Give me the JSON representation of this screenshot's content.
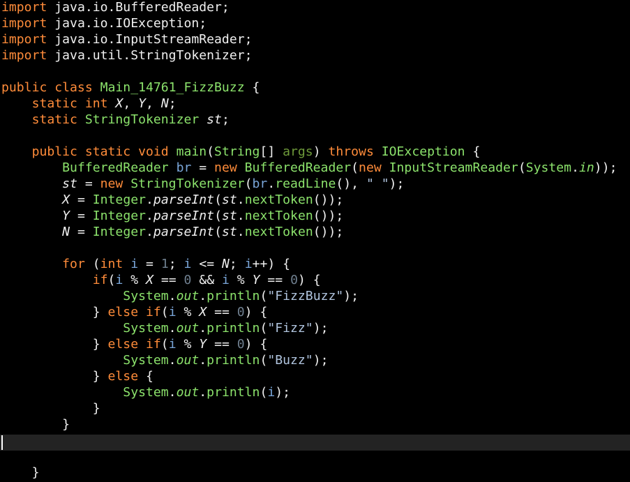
{
  "editor": {
    "language": "java",
    "theme_colors": {
      "background": "#000000",
      "keyword": "#ff8c3a",
      "default_text": "#f0f0f0",
      "type_and_method": "#8ce36c",
      "local_variable": "#7aa6d9",
      "parameter": "#6e9a3a",
      "number": "#6f7f8f",
      "string": "#b0c4de",
      "current_line": "#232323"
    },
    "current_line_index": 27,
    "lines": [
      [
        {
          "t": "import",
          "c": "keyword"
        },
        {
          "t": " java.io.BufferedReader;",
          "c": "plain"
        }
      ],
      [
        {
          "t": "import",
          "c": "keyword"
        },
        {
          "t": " java.io.IOException;",
          "c": "plain"
        }
      ],
      [
        {
          "t": "import",
          "c": "keyword"
        },
        {
          "t": " java.io.InputStreamReader;",
          "c": "plain"
        }
      ],
      [
        {
          "t": "import",
          "c": "keyword"
        },
        {
          "t": " java.util.StringTokenizer;",
          "c": "plain"
        }
      ],
      [],
      [
        {
          "t": "public class ",
          "c": "keyword"
        },
        {
          "t": "Main_14761_FizzBuzz",
          "c": "declaration"
        },
        {
          "t": " {",
          "c": "plain"
        }
      ],
      [
        {
          "t": "    ",
          "c": "plain"
        },
        {
          "t": "static int ",
          "c": "keyword"
        },
        {
          "t": "X",
          "c": "field"
        },
        {
          "t": ", ",
          "c": "plain"
        },
        {
          "t": "Y",
          "c": "field"
        },
        {
          "t": ", ",
          "c": "plain"
        },
        {
          "t": "N",
          "c": "field"
        },
        {
          "t": ";",
          "c": "plain"
        }
      ],
      [
        {
          "t": "    ",
          "c": "plain"
        },
        {
          "t": "static ",
          "c": "keyword"
        },
        {
          "t": "StringTokenizer ",
          "c": "type"
        },
        {
          "t": "st",
          "c": "field"
        },
        {
          "t": ";",
          "c": "plain"
        }
      ],
      [],
      [
        {
          "t": "    ",
          "c": "plain"
        },
        {
          "t": "public static void ",
          "c": "keyword"
        },
        {
          "t": "main",
          "c": "declaration"
        },
        {
          "t": "(",
          "c": "plain"
        },
        {
          "t": "String",
          "c": "type"
        },
        {
          "t": "[] ",
          "c": "plain"
        },
        {
          "t": "args",
          "c": "param"
        },
        {
          "t": ") ",
          "c": "plain"
        },
        {
          "t": "throws ",
          "c": "keyword"
        },
        {
          "t": "IOException",
          "c": "type"
        },
        {
          "t": " {",
          "c": "plain"
        }
      ],
      [
        {
          "t": "        ",
          "c": "plain"
        },
        {
          "t": "BufferedReader ",
          "c": "type"
        },
        {
          "t": "br",
          "c": "local"
        },
        {
          "t": " = ",
          "c": "plain"
        },
        {
          "t": "new ",
          "c": "keyword"
        },
        {
          "t": "BufferedReader",
          "c": "type"
        },
        {
          "t": "(",
          "c": "plain"
        },
        {
          "t": "new ",
          "c": "keyword"
        },
        {
          "t": "InputStreamReader",
          "c": "type"
        },
        {
          "t": "(",
          "c": "plain"
        },
        {
          "t": "System",
          "c": "type"
        },
        {
          "t": ".",
          "c": "plain"
        },
        {
          "t": "in",
          "c": "static-field"
        },
        {
          "t": "));",
          "c": "plain"
        }
      ],
      [
        {
          "t": "        ",
          "c": "plain"
        },
        {
          "t": "st",
          "c": "field"
        },
        {
          "t": " = ",
          "c": "plain"
        },
        {
          "t": "new ",
          "c": "keyword"
        },
        {
          "t": "StringTokenizer",
          "c": "type"
        },
        {
          "t": "(",
          "c": "plain"
        },
        {
          "t": "br",
          "c": "local"
        },
        {
          "t": ".",
          "c": "plain"
        },
        {
          "t": "readLine",
          "c": "method"
        },
        {
          "t": "(), ",
          "c": "plain"
        },
        {
          "t": "\" \"",
          "c": "string"
        },
        {
          "t": ");",
          "c": "plain"
        }
      ],
      [
        {
          "t": "        ",
          "c": "plain"
        },
        {
          "t": "X",
          "c": "field"
        },
        {
          "t": " = ",
          "c": "plain"
        },
        {
          "t": "Integer",
          "c": "type"
        },
        {
          "t": ".",
          "c": "plain"
        },
        {
          "t": "parseInt",
          "c": "static-method"
        },
        {
          "t": "(",
          "c": "plain"
        },
        {
          "t": "st",
          "c": "field"
        },
        {
          "t": ".",
          "c": "plain"
        },
        {
          "t": "nextToken",
          "c": "method"
        },
        {
          "t": "());",
          "c": "plain"
        }
      ],
      [
        {
          "t": "        ",
          "c": "plain"
        },
        {
          "t": "Y",
          "c": "field"
        },
        {
          "t": " = ",
          "c": "plain"
        },
        {
          "t": "Integer",
          "c": "type"
        },
        {
          "t": ".",
          "c": "plain"
        },
        {
          "t": "parseInt",
          "c": "static-method"
        },
        {
          "t": "(",
          "c": "plain"
        },
        {
          "t": "st",
          "c": "field"
        },
        {
          "t": ".",
          "c": "plain"
        },
        {
          "t": "nextToken",
          "c": "method"
        },
        {
          "t": "());",
          "c": "plain"
        }
      ],
      [
        {
          "t": "        ",
          "c": "plain"
        },
        {
          "t": "N",
          "c": "field"
        },
        {
          "t": " = ",
          "c": "plain"
        },
        {
          "t": "Integer",
          "c": "type"
        },
        {
          "t": ".",
          "c": "plain"
        },
        {
          "t": "parseInt",
          "c": "static-method"
        },
        {
          "t": "(",
          "c": "plain"
        },
        {
          "t": "st",
          "c": "field"
        },
        {
          "t": ".",
          "c": "plain"
        },
        {
          "t": "nextToken",
          "c": "method"
        },
        {
          "t": "());",
          "c": "plain"
        }
      ],
      [],
      [
        {
          "t": "        ",
          "c": "plain"
        },
        {
          "t": "for ",
          "c": "keyword"
        },
        {
          "t": "(",
          "c": "plain"
        },
        {
          "t": "int ",
          "c": "keyword"
        },
        {
          "t": "i",
          "c": "local"
        },
        {
          "t": " = ",
          "c": "plain"
        },
        {
          "t": "1",
          "c": "number"
        },
        {
          "t": "; ",
          "c": "plain"
        },
        {
          "t": "i",
          "c": "local"
        },
        {
          "t": " <= ",
          "c": "plain"
        },
        {
          "t": "N",
          "c": "field"
        },
        {
          "t": "; ",
          "c": "plain"
        },
        {
          "t": "i",
          "c": "local"
        },
        {
          "t": "++) {",
          "c": "plain"
        }
      ],
      [
        {
          "t": "            ",
          "c": "plain"
        },
        {
          "t": "if",
          "c": "keyword"
        },
        {
          "t": "(",
          "c": "plain"
        },
        {
          "t": "i",
          "c": "local"
        },
        {
          "t": " % ",
          "c": "plain"
        },
        {
          "t": "X",
          "c": "field"
        },
        {
          "t": " == ",
          "c": "plain"
        },
        {
          "t": "0",
          "c": "number"
        },
        {
          "t": " && ",
          "c": "plain"
        },
        {
          "t": "i",
          "c": "local"
        },
        {
          "t": " % ",
          "c": "plain"
        },
        {
          "t": "Y",
          "c": "field"
        },
        {
          "t": " == ",
          "c": "plain"
        },
        {
          "t": "0",
          "c": "number"
        },
        {
          "t": ") {",
          "c": "plain"
        }
      ],
      [
        {
          "t": "                ",
          "c": "plain"
        },
        {
          "t": "System",
          "c": "type"
        },
        {
          "t": ".",
          "c": "plain"
        },
        {
          "t": "out",
          "c": "static-field"
        },
        {
          "t": ".",
          "c": "plain"
        },
        {
          "t": "println",
          "c": "method"
        },
        {
          "t": "(",
          "c": "plain"
        },
        {
          "t": "\"FizzBuzz\"",
          "c": "string"
        },
        {
          "t": ");",
          "c": "plain"
        }
      ],
      [
        {
          "t": "            } ",
          "c": "plain"
        },
        {
          "t": "else if",
          "c": "keyword"
        },
        {
          "t": "(",
          "c": "plain"
        },
        {
          "t": "i",
          "c": "local"
        },
        {
          "t": " % ",
          "c": "plain"
        },
        {
          "t": "X",
          "c": "field"
        },
        {
          "t": " == ",
          "c": "plain"
        },
        {
          "t": "0",
          "c": "number"
        },
        {
          "t": ") {",
          "c": "plain"
        }
      ],
      [
        {
          "t": "                ",
          "c": "plain"
        },
        {
          "t": "System",
          "c": "type"
        },
        {
          "t": ".",
          "c": "plain"
        },
        {
          "t": "out",
          "c": "static-field"
        },
        {
          "t": ".",
          "c": "plain"
        },
        {
          "t": "println",
          "c": "method"
        },
        {
          "t": "(",
          "c": "plain"
        },
        {
          "t": "\"Fizz\"",
          "c": "string"
        },
        {
          "t": ");",
          "c": "plain"
        }
      ],
      [
        {
          "t": "            } ",
          "c": "plain"
        },
        {
          "t": "else if",
          "c": "keyword"
        },
        {
          "t": "(",
          "c": "plain"
        },
        {
          "t": "i",
          "c": "local"
        },
        {
          "t": " % ",
          "c": "plain"
        },
        {
          "t": "Y",
          "c": "field"
        },
        {
          "t": " == ",
          "c": "plain"
        },
        {
          "t": "0",
          "c": "number"
        },
        {
          "t": ") {",
          "c": "plain"
        }
      ],
      [
        {
          "t": "                ",
          "c": "plain"
        },
        {
          "t": "System",
          "c": "type"
        },
        {
          "t": ".",
          "c": "plain"
        },
        {
          "t": "out",
          "c": "static-field"
        },
        {
          "t": ".",
          "c": "plain"
        },
        {
          "t": "println",
          "c": "method"
        },
        {
          "t": "(",
          "c": "plain"
        },
        {
          "t": "\"Buzz\"",
          "c": "string"
        },
        {
          "t": ");",
          "c": "plain"
        }
      ],
      [
        {
          "t": "            } ",
          "c": "plain"
        },
        {
          "t": "else",
          "c": "keyword"
        },
        {
          "t": " {",
          "c": "plain"
        }
      ],
      [
        {
          "t": "                ",
          "c": "plain"
        },
        {
          "t": "System",
          "c": "type"
        },
        {
          "t": ".",
          "c": "plain"
        },
        {
          "t": "out",
          "c": "static-field"
        },
        {
          "t": ".",
          "c": "plain"
        },
        {
          "t": "println",
          "c": "method"
        },
        {
          "t": "(",
          "c": "plain"
        },
        {
          "t": "i",
          "c": "local"
        },
        {
          "t": ");",
          "c": "plain"
        }
      ],
      [
        {
          "t": "            }",
          "c": "plain"
        }
      ],
      [
        {
          "t": "        }",
          "c": "plain"
        }
      ],
      [],
      [],
      [
        {
          "t": "    }",
          "c": "plain"
        }
      ],
      [
        {
          "t": "}",
          "c": "plain"
        }
      ]
    ]
  }
}
